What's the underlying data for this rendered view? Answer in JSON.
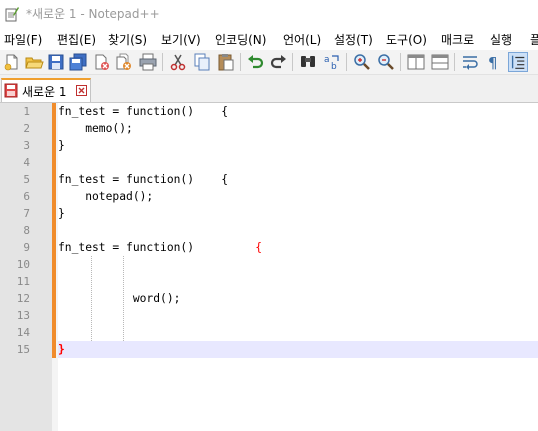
{
  "window": {
    "title": "*새로운 1 - Notepad++"
  },
  "menu": [
    "파일(F)",
    "편집(E)",
    "찾기(S)",
    "보기(V)",
    "인코딩(N)",
    "언어(L)",
    "설정(T)",
    "도구(O)",
    "매크로",
    "실행",
    "플"
  ],
  "toolbar": {
    "icons": [
      "new-file-icon",
      "open-file-icon",
      "save-icon",
      "save-all-icon",
      "close-icon",
      "close-all-icon",
      "print-icon",
      "cut-icon",
      "copy-icon",
      "paste-icon",
      "undo-icon",
      "redo-icon",
      "find-icon",
      "replace-icon",
      "zoom-in-icon",
      "zoom-out-icon",
      "sync-vertical-icon",
      "sync-horizontal-icon",
      "word-wrap-icon",
      "show-all-chars-icon",
      "indent-guide-icon"
    ]
  },
  "tab": {
    "label": "새로운 1"
  },
  "editor": {
    "line_numbers": [
      "1",
      "2",
      "3",
      "4",
      "5",
      "6",
      "7",
      "8",
      "9",
      "10",
      "11",
      "12",
      "13",
      "14",
      "15"
    ],
    "lines": [
      {
        "text": "fn_test = function()    {",
        "brace": ""
      },
      {
        "text": "    memo();",
        "brace": ""
      },
      {
        "text": "}",
        "brace": ""
      },
      {
        "text": "",
        "brace": ""
      },
      {
        "text": "fn_test = function()    {",
        "brace": ""
      },
      {
        "text": "    notepad();",
        "brace": ""
      },
      {
        "text": "}",
        "brace": ""
      },
      {
        "text": "",
        "brace": ""
      },
      {
        "text": "fn_test = function()         ",
        "brace": "{"
      },
      {
        "text": "",
        "brace": ""
      },
      {
        "text": "",
        "brace": ""
      },
      {
        "text": "           word();",
        "brace": ""
      },
      {
        "text": "",
        "brace": ""
      },
      {
        "text": "",
        "brace": ""
      },
      {
        "text": "",
        "brace": "}"
      }
    ]
  }
}
